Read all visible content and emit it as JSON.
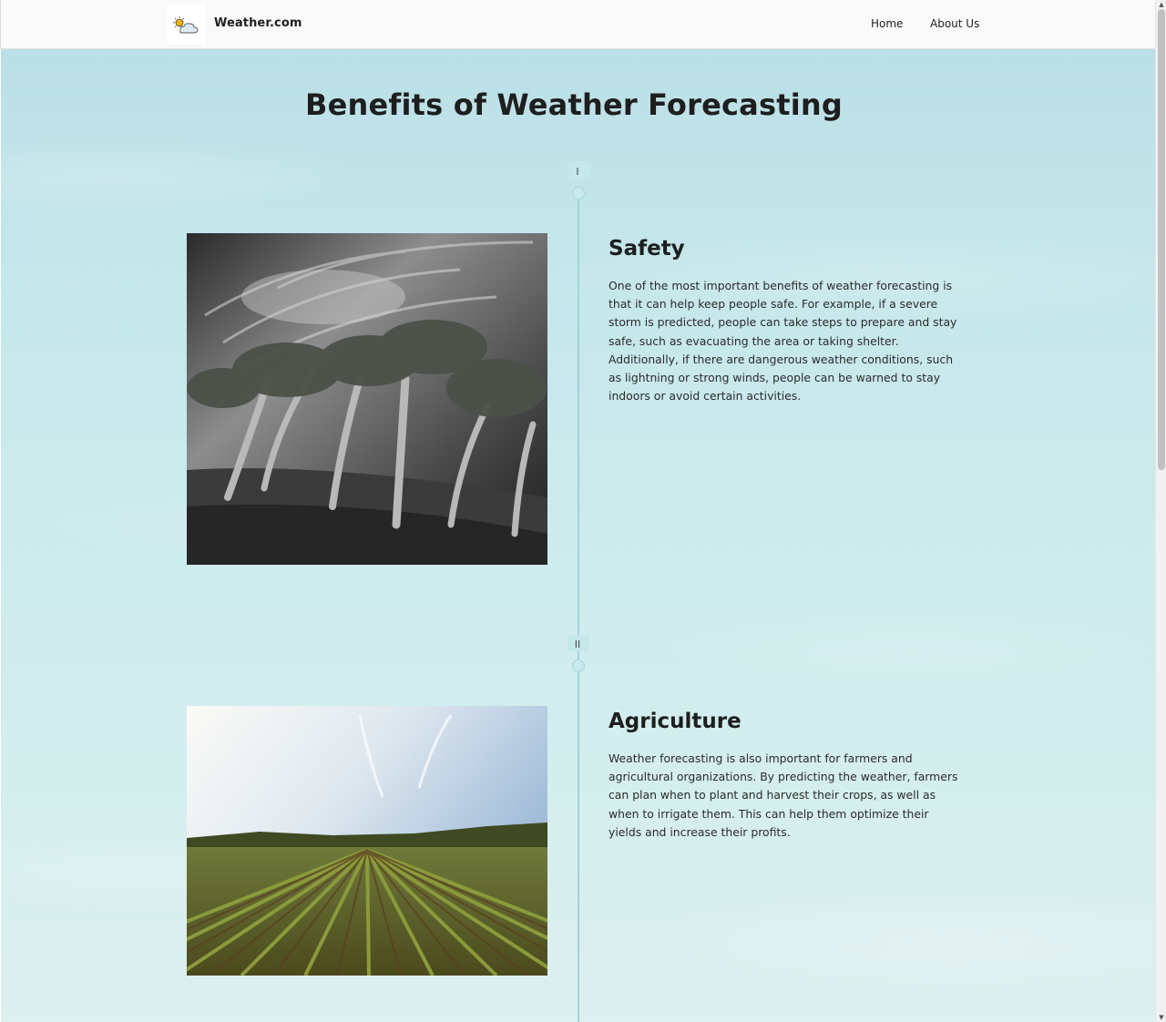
{
  "header": {
    "brand": "Weather.com",
    "logo_icon": "sun-cloud-icon",
    "nav": [
      {
        "label": "Home"
      },
      {
        "label": "About Us"
      }
    ]
  },
  "main": {
    "title": "Benefits of Weather Forecasting",
    "sections": [
      {
        "numeral": "I",
        "title": "Safety",
        "text": "One of the most important benefits of weather forecasting is that it can help keep people safe. For example, if a severe storm is predicted, people can take steps to prepare and stay safe, such as evacuating the area or taking shelter. Additionally, if there are dangerous weather conditions, such as lightning or strong winds, people can be warned to stay indoors or avoid certain activities.",
        "image": "windswept-trees-photo"
      },
      {
        "numeral": "II",
        "title": "Agriculture",
        "text": "Weather forecasting is also important for farmers and agricultural organizations. By predicting the weather, farmers can plan when to plant and harvest their crops, as well as when to irrigate them. This can help them optimize their yields and increase their profits.",
        "image": "crop-field-photo"
      }
    ]
  },
  "colors": {
    "sky_top": "#badfe6",
    "sky_bottom": "#ddefee",
    "timeline": "#9fd4da",
    "text": "#1e1e1e"
  }
}
